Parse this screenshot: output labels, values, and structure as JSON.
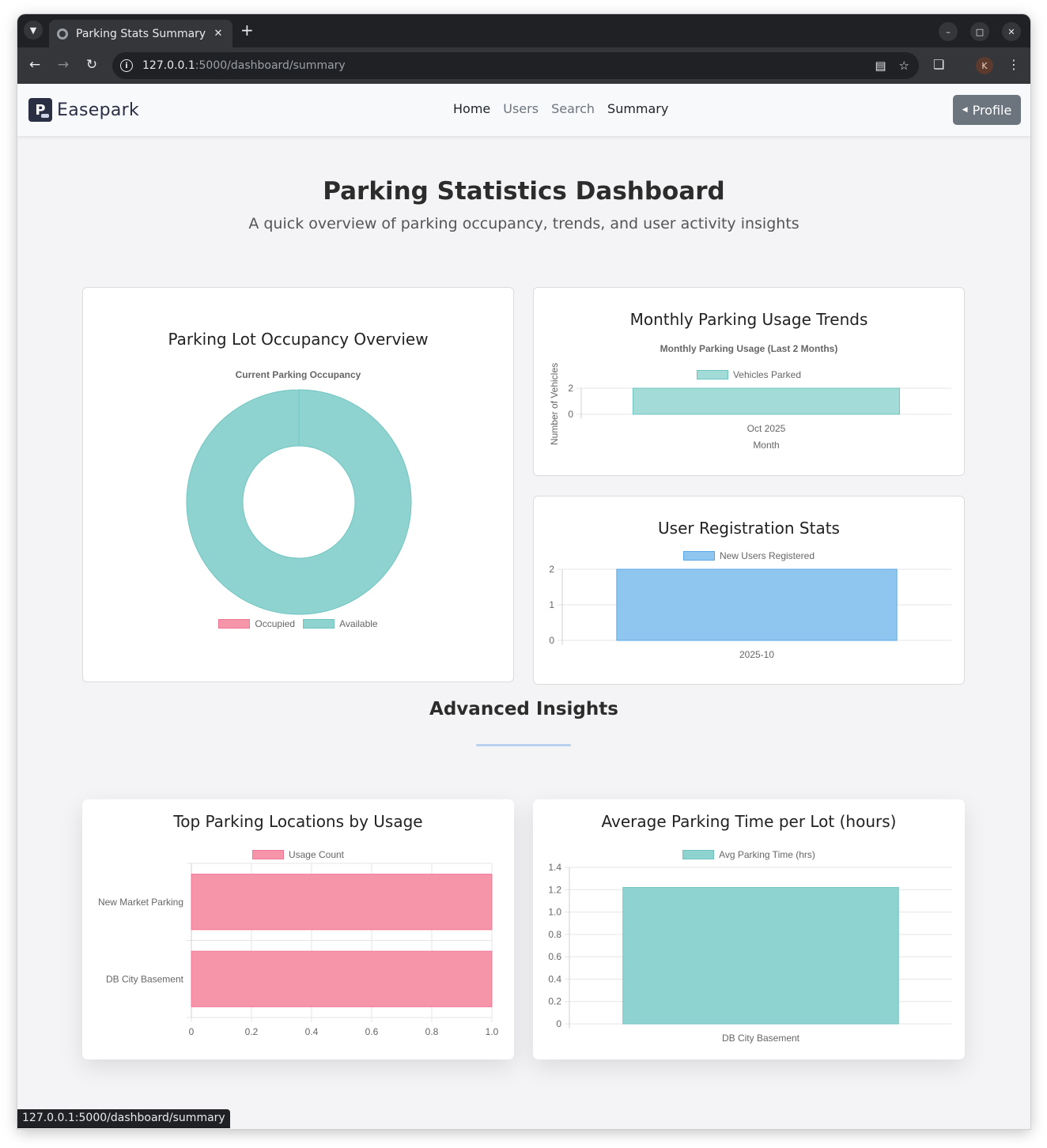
{
  "browser": {
    "tab_title": "Parking Stats Summary",
    "url_host": "127.0.0.1",
    "url_path": ":5000/dashboard/summary",
    "avatar_letter": "K",
    "status_url": "127.0.0.1:5000/dashboard/summary"
  },
  "navbar": {
    "brand": "Easepark",
    "brand_logo_letter": "P",
    "links": [
      "Home",
      "Users",
      "Search",
      "Summary"
    ],
    "profile_label": "Profile"
  },
  "header": {
    "title": "Parking Statistics Dashboard",
    "subtitle": "A quick overview of parking occupancy, trends, and user activity insights"
  },
  "advanced": {
    "title": "Advanced Insights"
  },
  "colors": {
    "pink": "#f694aa",
    "teal": "#8fd3d0",
    "blue": "#8fc6f0",
    "teal_light": "#a3dbd9"
  },
  "chart_data": [
    {
      "id": "occupancy",
      "card_title": "Parking Lot Occupancy Overview",
      "type": "pie",
      "title": "Current Parking Occupancy",
      "categories": [
        "Occupied",
        "Available"
      ],
      "values": [
        0,
        1
      ]
    },
    {
      "id": "monthly",
      "card_title": "Monthly Parking Usage Trends",
      "type": "bar",
      "title": "Monthly Parking Usage (Last 2 Months)",
      "categories": [
        "Oct 2025"
      ],
      "series": [
        {
          "name": "Vehicles Parked",
          "values": [
            2
          ]
        }
      ],
      "xlabel": "Month",
      "ylabel": "Number of Vehicles",
      "ylim": [
        0,
        2
      ],
      "yticks": [
        "0",
        "2"
      ]
    },
    {
      "id": "registration",
      "card_title": "User Registration Stats",
      "type": "bar",
      "categories": [
        "2025-10"
      ],
      "series": [
        {
          "name": "New Users Registered",
          "values": [
            2
          ]
        }
      ],
      "ylim": [
        0,
        2
      ],
      "yticks": [
        "0",
        "1",
        "2"
      ]
    },
    {
      "id": "top_locations",
      "card_title": "Top Parking Locations by Usage",
      "type": "bar",
      "orientation": "horizontal",
      "categories": [
        "New Market Parking",
        "DB City Basement"
      ],
      "series": [
        {
          "name": "Usage Count",
          "values": [
            1,
            1
          ]
        }
      ],
      "xlim": [
        0,
        1
      ],
      "xticks": [
        "0",
        "0.2",
        "0.4",
        "0.6",
        "0.8",
        "1.0"
      ]
    },
    {
      "id": "avg_time",
      "card_title": "Average Parking Time per Lot (hours)",
      "type": "bar",
      "categories": [
        "DB City Basement"
      ],
      "series": [
        {
          "name": "Avg Parking Time (hrs)",
          "values": [
            1.22
          ]
        }
      ],
      "ylim": [
        0,
        1.4
      ],
      "yticks": [
        "0",
        "0.2",
        "0.4",
        "0.6",
        "0.8",
        "1.0",
        "1.2",
        "1.4"
      ]
    }
  ]
}
